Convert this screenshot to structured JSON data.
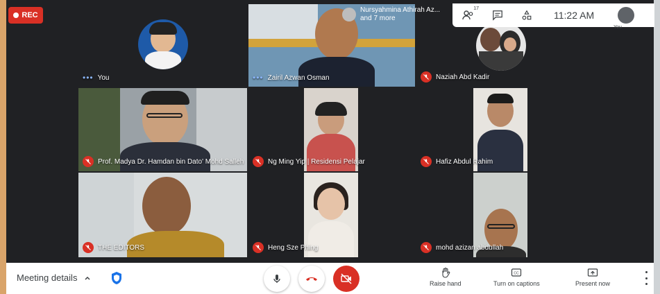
{
  "recording": {
    "label": "REC"
  },
  "presenter_note": {
    "line1": "Nursyahmina Athirah Az...",
    "line2": "and 7 more"
  },
  "topbar": {
    "participants_count": "17",
    "time": "11:22 AM",
    "self_label": "You"
  },
  "tiles": [
    {
      "name": "You",
      "muted": false
    },
    {
      "name": "Zairil Azwan Osman",
      "muted": false
    },
    {
      "name": "Naziah Abd Kadir",
      "muted": true
    },
    {
      "name": "Prof. Madya Dr. Hamdan bin Dato' Mohd Salleh",
      "muted": true
    },
    {
      "name": "Ng Ming Yip | Residensi Pelajar",
      "muted": true
    },
    {
      "name": "Hafiz Abdul Rahim",
      "muted": true
    },
    {
      "name": "THE EDITORS",
      "muted": true
    },
    {
      "name": "Heng Sze Phing",
      "muted": true
    },
    {
      "name": "mohd azizan abdullah",
      "muted": true
    }
  ],
  "bottombar": {
    "meeting_details": "Meeting details",
    "raise_hand": "Raise hand",
    "captions": "Turn on captions",
    "present": "Present now"
  },
  "colors": {
    "danger": "#d93025",
    "accent": "#1a73e8",
    "background": "#202124"
  }
}
